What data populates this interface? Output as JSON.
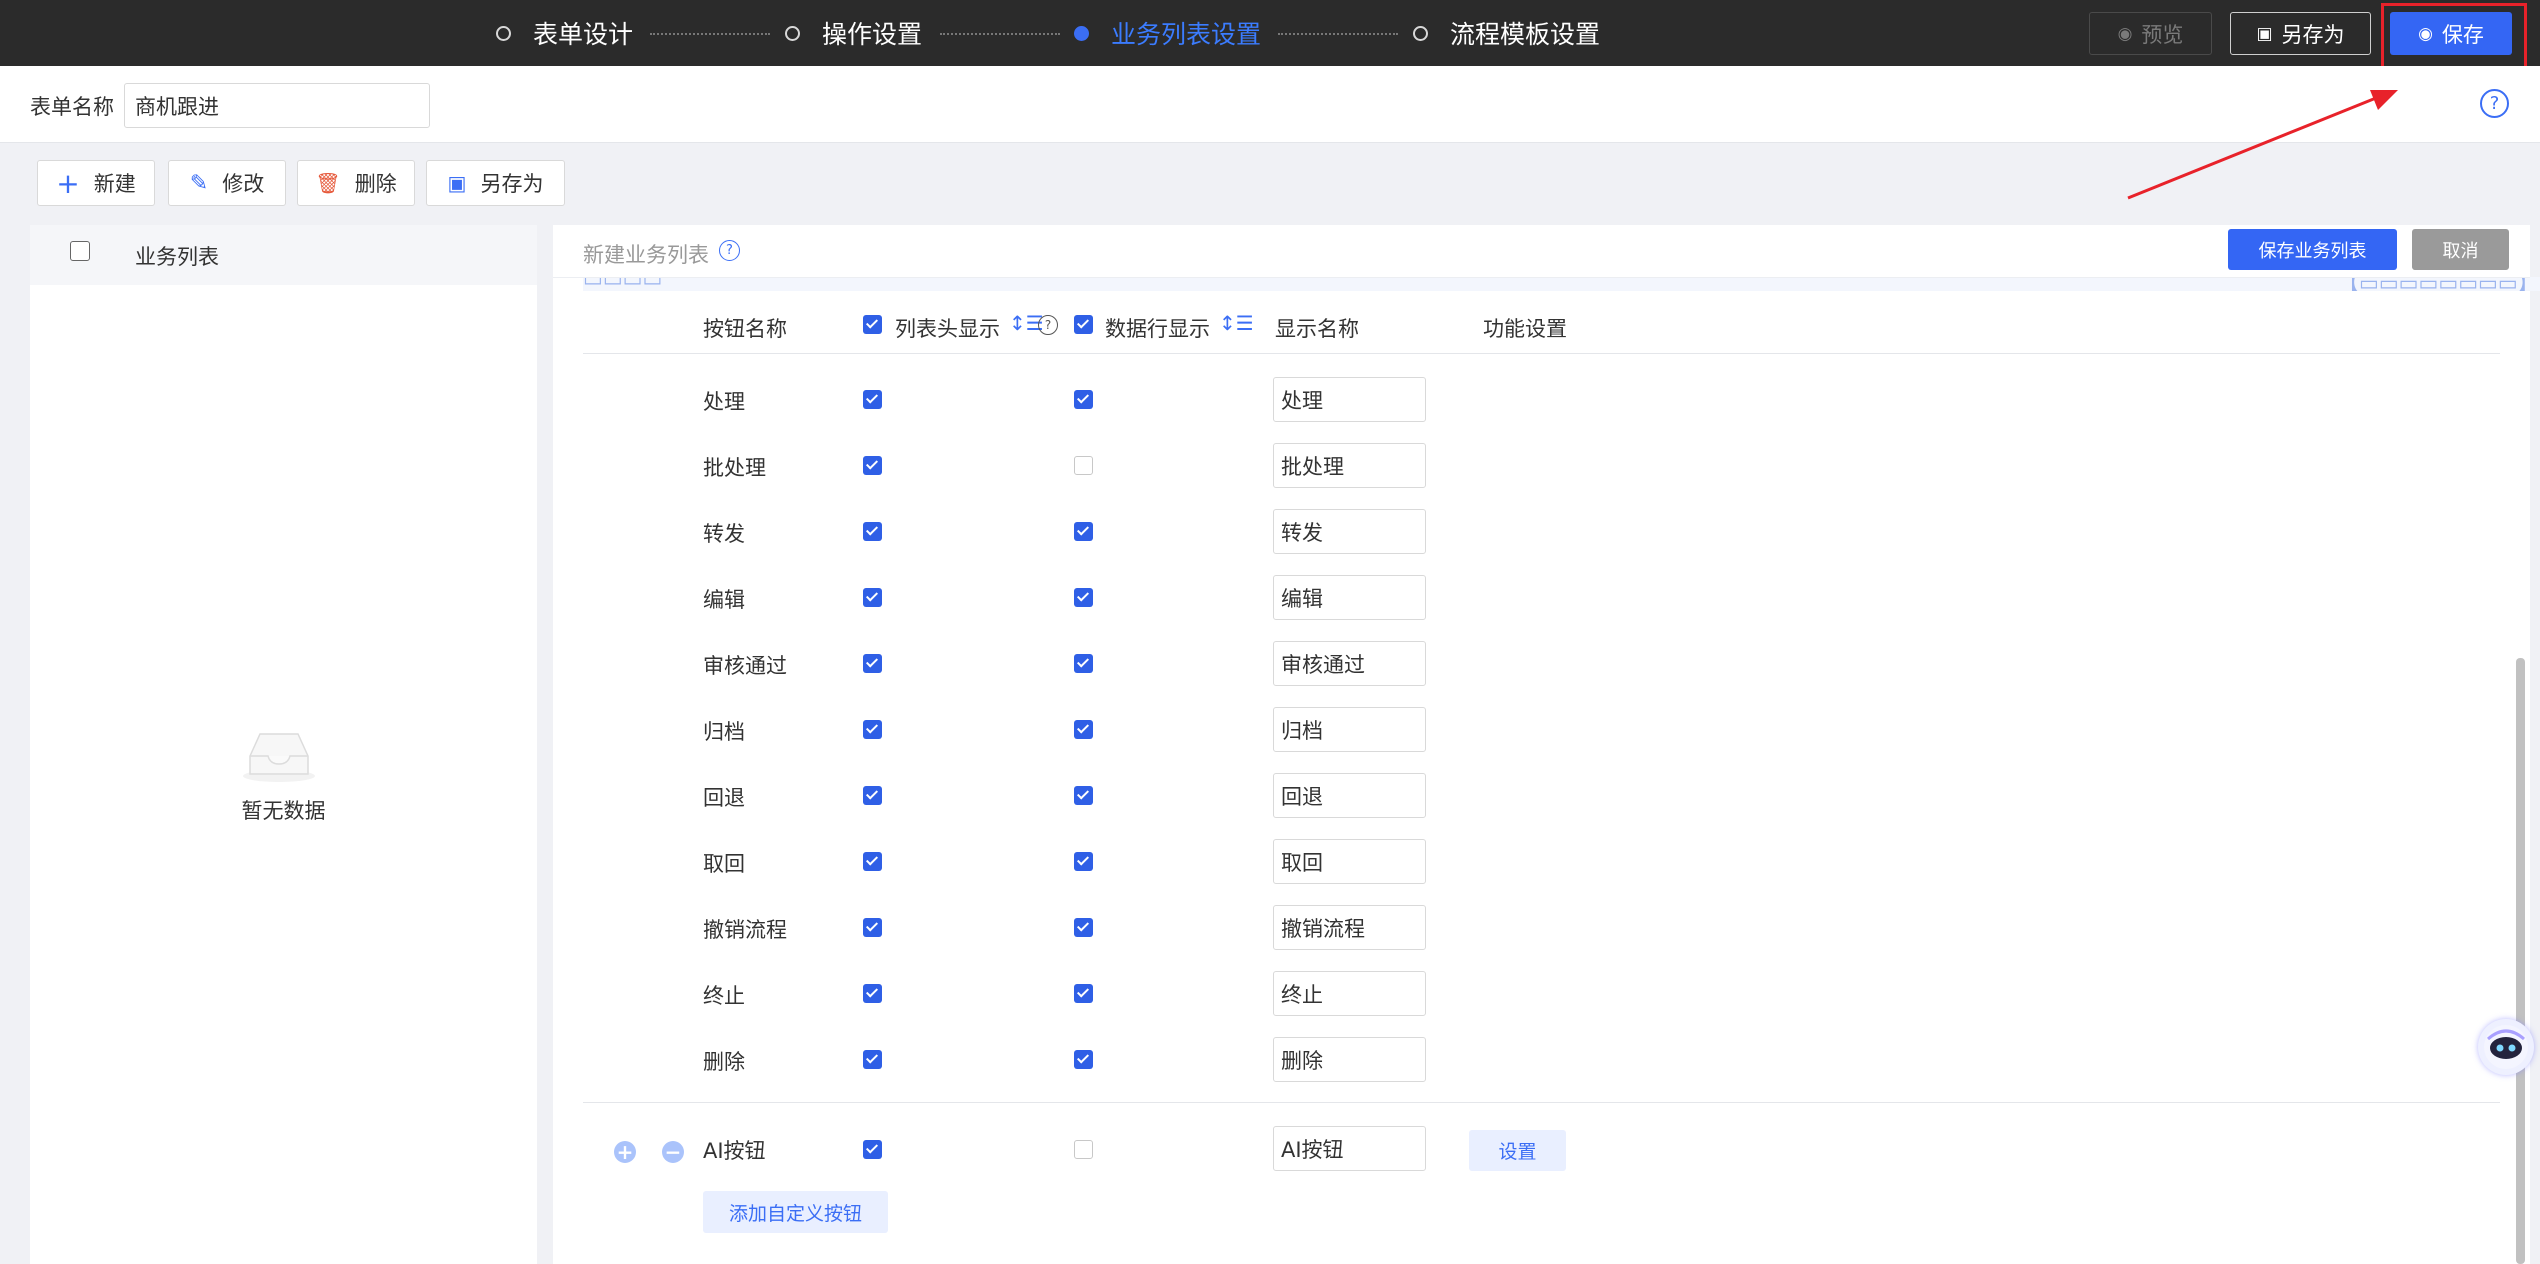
{
  "steps": [
    {
      "label": "表单设计",
      "active": false
    },
    {
      "label": "操作设置",
      "active": false
    },
    {
      "label": "业务列表设置",
      "active": true
    },
    {
      "label": "流程模板设置",
      "active": false
    }
  ],
  "top_buttons": {
    "preview": "预览",
    "save_as": "另存为",
    "save": "保存"
  },
  "form_name": {
    "label": "表单名称",
    "value": "商机跟进"
  },
  "toolbar": {
    "new": "新建",
    "edit": "修改",
    "delete": "删除",
    "save_as": "另存为"
  },
  "left_panel": {
    "header": "业务列表",
    "empty": "暂无数据"
  },
  "right_panel": {
    "title": "新建业务列表",
    "save_btn": "保存业务列表",
    "cancel_btn": "取消",
    "columns": {
      "name": "按钮名称",
      "header_show": "列表头显示",
      "row_show": "数据行显示",
      "display_name": "显示名称",
      "func": "功能设置"
    },
    "rows": [
      {
        "name": "处理",
        "header": true,
        "row": true,
        "display": "处理"
      },
      {
        "name": "批处理",
        "header": true,
        "row": false,
        "display": "批处理"
      },
      {
        "name": "转发",
        "header": true,
        "row": true,
        "display": "转发"
      },
      {
        "name": "编辑",
        "header": true,
        "row": true,
        "display": "编辑"
      },
      {
        "name": "审核通过",
        "header": true,
        "row": true,
        "display": "审核通过"
      },
      {
        "name": "归档",
        "header": true,
        "row": true,
        "display": "归档"
      },
      {
        "name": "回退",
        "header": true,
        "row": true,
        "display": "回退"
      },
      {
        "name": "取回",
        "header": true,
        "row": true,
        "display": "取回"
      },
      {
        "name": "撤销流程",
        "header": true,
        "row": true,
        "display": "撤销流程"
      },
      {
        "name": "终止",
        "header": true,
        "row": true,
        "display": "终止"
      },
      {
        "name": "删除",
        "header": true,
        "row": true,
        "display": "删除"
      }
    ],
    "custom_row": {
      "name": "AI按钮",
      "header": true,
      "row": false,
      "display": "AI按钮",
      "setting": "设置"
    },
    "add_custom": "添加自定义按钮"
  },
  "colors": {
    "accent": "#3466f4",
    "topbar": "#2b2b2b",
    "active_step": "#3b7cff",
    "highlight": "#e8222a"
  }
}
